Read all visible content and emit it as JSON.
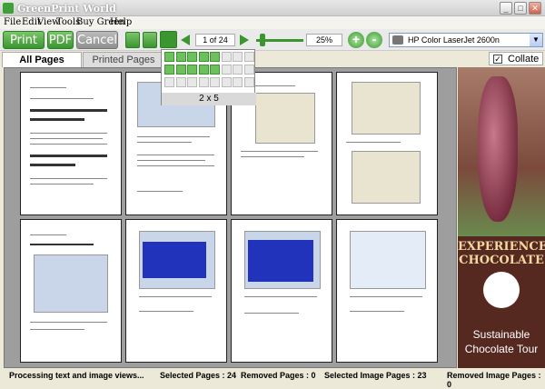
{
  "window": {
    "title": "GreenPrint World"
  },
  "menu": [
    "File",
    "Edit",
    "View",
    "Tools",
    "Buy Green",
    "Help"
  ],
  "toolbar": {
    "print_label": "Print",
    "pdf_label": "PDF",
    "cancel_label": "Cancel",
    "page_indicator": "1 of 24",
    "zoom_value": "25%",
    "zoom_in_label": "+",
    "zoom_out_label": "-",
    "printer_name": "HP Color LaserJet 2600n"
  },
  "tabs": [
    {
      "label": "All Pages"
    },
    {
      "label": "Printed Pages"
    }
  ],
  "collate": {
    "label": "Collate",
    "checked": true,
    "mark": "✓"
  },
  "layout_popup": {
    "label": "2 x 5",
    "cols": 8,
    "rows": 2,
    "selected_cols": 5,
    "selected_rows": 2
  },
  "ad": {
    "headline_1": "EXPERIENCE",
    "headline_2": "CHOCOLATE",
    "line_1": "Sustainable",
    "line_2": "Chocolate Tour"
  },
  "status": {
    "processing": "Processing text and image views...",
    "selected_pages": "Selected Pages : 24",
    "removed_pages": "Removed Pages : 0",
    "selected_image_pages": "Selected Image Pages : 23",
    "removed_image_pages": "Removed Image Pages : 0"
  },
  "colors": {
    "accent_green": "#3b962f",
    "ad_background": "#552820"
  }
}
